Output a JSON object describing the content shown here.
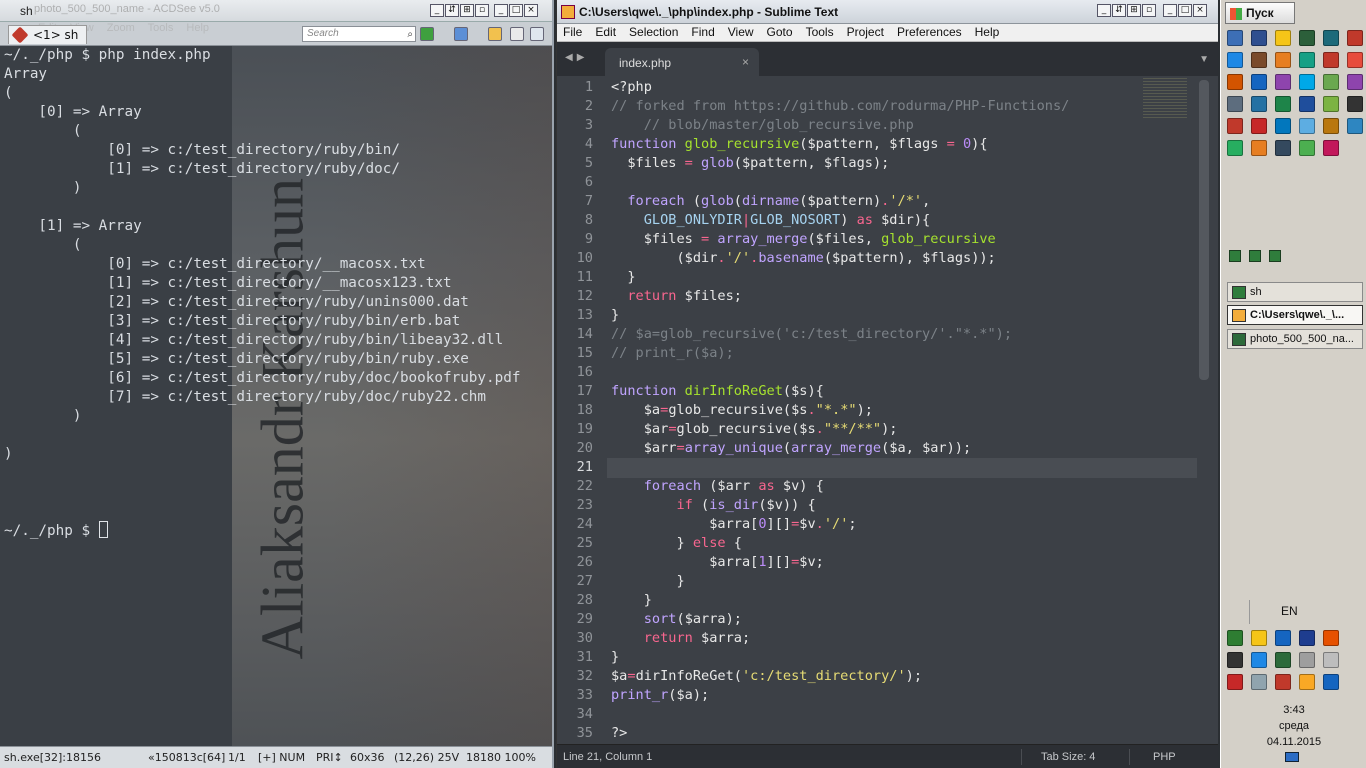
{
  "console": {
    "title": "sh",
    "ghost_title": "photo_500_500_name - ACDSee v5.0",
    "ghost_menu": "Edit View Zoom Tools Help",
    "tab_label": "<1> sh",
    "search_placeholder": "Search",
    "lines": [
      "~/._/php $ php index.php",
      "Array",
      "(",
      "    [0] => Array",
      "        (",
      "            [0] => c:/test_directory/ruby/bin/",
      "            [1] => c:/test_directory/ruby/doc/",
      "        )",
      "",
      "    [1] => Array",
      "        (",
      "            [0] => c:/test_directory/__macosx.txt",
      "            [1] => c:/test_directory/__macosx123.txt",
      "            [2] => c:/test_directory/ruby/unins000.dat",
      "            [3] => c:/test_directory/ruby/bin/erb.bat",
      "            [4] => c:/test_directory/ruby/bin/libeay32.dll",
      "            [5] => c:/test_directory/ruby/bin/ruby.exe",
      "            [6] => c:/test_directory/ruby/doc/bookofruby.pdf",
      "            [7] => c:/test_directory/ruby/doc/ruby22.chm",
      "        )",
      "",
      ")",
      "",
      "",
      ""
    ],
    "prompt": "~/._/php $ ",
    "watermark": "Aliaksandr Karshun",
    "status": {
      "process": "sh.exe[32]:18156",
      "build": "«150813c[64]",
      "position": "1/1",
      "mode": "[+] NUM",
      "pri": "PRI↕",
      "size": "60x36",
      "cursor": "(12,26) 25V",
      "memory": "18180 100%"
    }
  },
  "editor": {
    "title": "C:\\Users\\qwe\\._\\php\\index.php - Sublime Text",
    "menu": [
      "File",
      "Edit",
      "Selection",
      "Find",
      "View",
      "Goto",
      "Tools",
      "Project",
      "Preferences",
      "Help"
    ],
    "tab": "index.php",
    "tab_close": "×",
    "line_numbers": [
      "1",
      "2",
      "3",
      "4",
      "5",
      "6",
      "7",
      "8",
      "9",
      "10",
      "11",
      "12",
      "13",
      "14",
      "15",
      "16",
      "17",
      "18",
      "19",
      "20",
      "21",
      "22",
      "23",
      "24",
      "25",
      "26",
      "27",
      "28",
      "29",
      "30",
      "31",
      "32",
      "33",
      "34",
      "35"
    ],
    "status": {
      "position": "Line 21, Column 1",
      "tab_size": "Tab Size: 4",
      "syntax": "PHP"
    }
  },
  "taskbar": {
    "start_label": "Пуск",
    "tasks": [
      {
        "label": "sh",
        "active": false
      },
      {
        "label": "C:\\Users\\qwe\\._\\...",
        "active": true
      },
      {
        "label": "photo_500_500_na...",
        "active": false
      }
    ],
    "language": "EN",
    "time": "3:43",
    "weekday": "среда",
    "date": "04.11.2015"
  },
  "colors": {
    "php_keyword": "#c0a4ff",
    "php_function": "#a6e22e",
    "php_operator": "#f8668f",
    "php_string": "#e6db74",
    "php_comment": "#7c8288"
  }
}
